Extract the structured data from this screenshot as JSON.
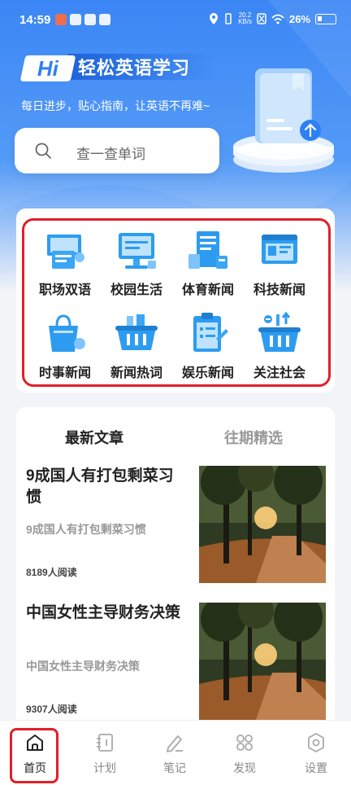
{
  "status": {
    "time": "14:59",
    "net_speed_top": "20.2",
    "net_speed_bottom": "KB/s",
    "battery": "26%"
  },
  "header": {
    "logo_text": "Hi",
    "app_title": "轻松英语学习",
    "slogan": "每日进步，贴心指南，让英语不再难~"
  },
  "search": {
    "placeholder": "查一查单词"
  },
  "categories": [
    {
      "label": "职场双语",
      "icon": "briefcase-icon"
    },
    {
      "label": "校园生活",
      "icon": "monitor-icon"
    },
    {
      "label": "体育新闻",
      "icon": "receipt-icon"
    },
    {
      "label": "科技新闻",
      "icon": "browser-window-icon"
    },
    {
      "label": "时事新闻",
      "icon": "shopping-bag-icon"
    },
    {
      "label": "新闻热词",
      "icon": "basket-icon"
    },
    {
      "label": "娱乐新闻",
      "icon": "clipboard-icon"
    },
    {
      "label": "关注社会",
      "icon": "basket-arrows-icon"
    }
  ],
  "article_tabs": [
    {
      "label": "最新文章",
      "active": true
    },
    {
      "label": "往期精选",
      "active": false
    }
  ],
  "articles": [
    {
      "title": "9成国人有打包剩菜习惯",
      "subtitle": "9成国人有打包剩菜习惯",
      "reads": "8189人阅读"
    },
    {
      "title": "中国女性主导财务决策",
      "subtitle": "中国女性主导财务决策",
      "reads": "9307人阅读"
    }
  ],
  "tabbar": [
    {
      "label": "首页",
      "icon": "home-icon",
      "active": true
    },
    {
      "label": "计划",
      "icon": "notebook-icon",
      "active": false
    },
    {
      "label": "笔记",
      "icon": "pen-icon",
      "active": false
    },
    {
      "label": "发现",
      "icon": "grid-circles-icon",
      "active": false
    },
    {
      "label": "设置",
      "icon": "hexagon-settings-icon",
      "active": false
    }
  ],
  "colors": {
    "brand_blue": "#2f7ff5",
    "highlight_red": "#e0202a",
    "icon_blue": "#2d9cf0"
  }
}
